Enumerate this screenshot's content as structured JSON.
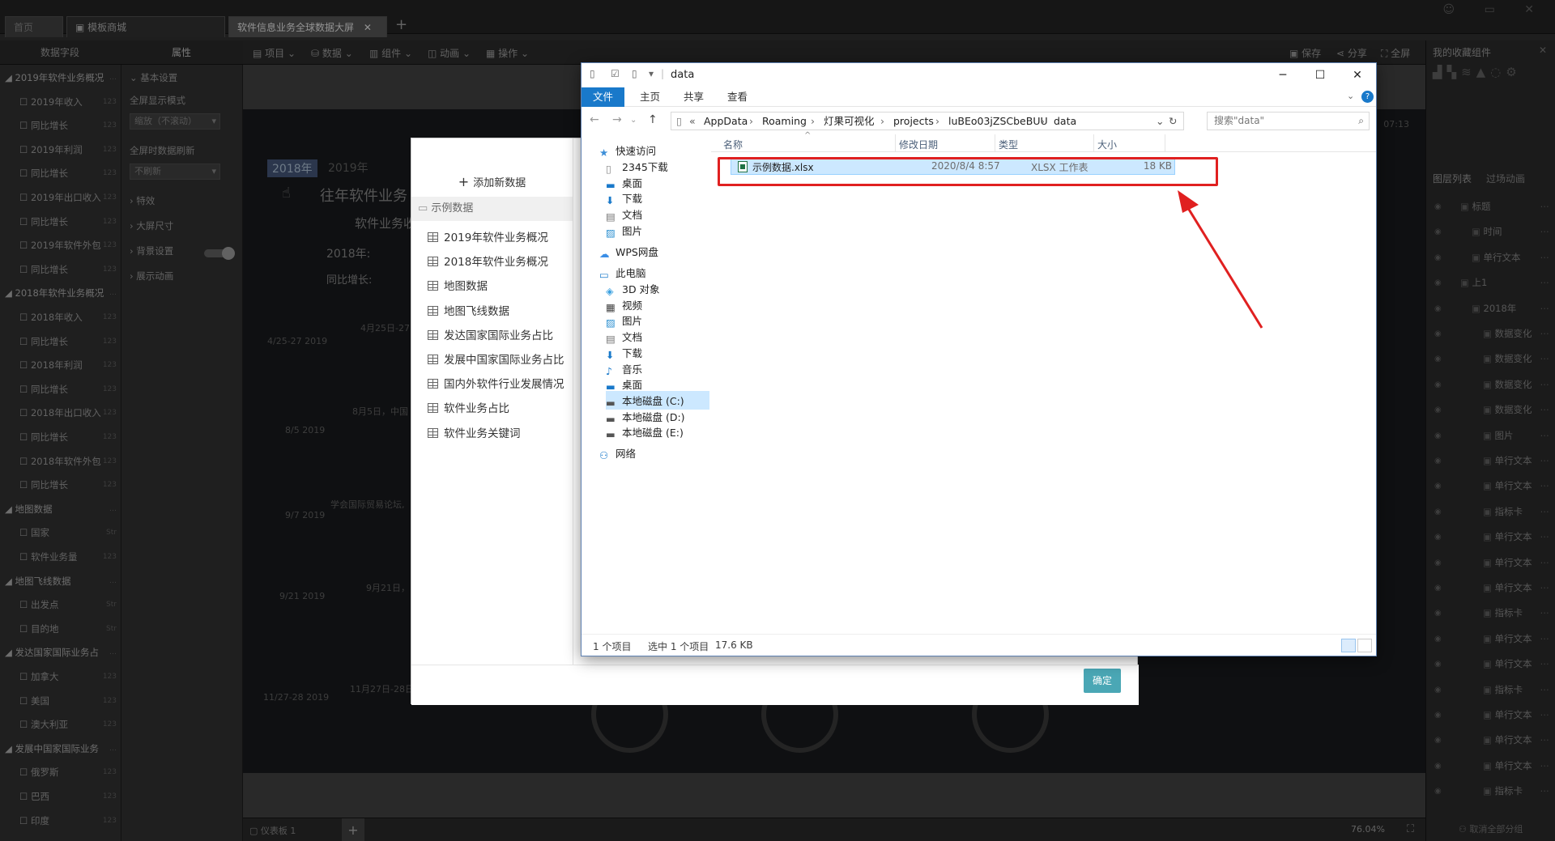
{
  "app": {
    "tabs": [
      {
        "label": "首页"
      },
      {
        "label": "模板商城"
      },
      {
        "label": "软件信息业务全球数据大屏"
      }
    ],
    "new_tab": "+"
  },
  "left": {
    "fields_title": "数据字段",
    "props_title": "属性",
    "fields": [
      {
        "label": "2019年软件业务概况",
        "kind": "group"
      },
      {
        "label": "2019年收入",
        "type": "123"
      },
      {
        "label": "同比增长",
        "type": "123"
      },
      {
        "label": "2019年利润",
        "type": "123"
      },
      {
        "label": "同比增长",
        "type": "123"
      },
      {
        "label": "2019年出口收入",
        "type": "123"
      },
      {
        "label": "同比增长",
        "type": "123"
      },
      {
        "label": "2019年软件外包",
        "type": "123"
      },
      {
        "label": "同比增长",
        "type": "123"
      },
      {
        "label": "2018年软件业务概况",
        "kind": "group"
      },
      {
        "label": "2018年收入",
        "type": "123"
      },
      {
        "label": "同比增长",
        "type": "123"
      },
      {
        "label": "2018年利润",
        "type": "123"
      },
      {
        "label": "同比增长",
        "type": "123"
      },
      {
        "label": "2018年出口收入",
        "type": "123"
      },
      {
        "label": "同比增长",
        "type": "123"
      },
      {
        "label": "2018年软件外包",
        "type": "123"
      },
      {
        "label": "同比增长",
        "type": "123"
      },
      {
        "label": "地图数据",
        "kind": "group"
      },
      {
        "label": "国家",
        "type": "Str"
      },
      {
        "label": "软件业务量",
        "type": "123"
      },
      {
        "label": "地图飞线数据",
        "kind": "group"
      },
      {
        "label": "出发点",
        "type": "Str"
      },
      {
        "label": "目的地",
        "type": "Str"
      },
      {
        "label": "发达国家国际业务占",
        "kind": "group"
      },
      {
        "label": "加拿大",
        "type": "123"
      },
      {
        "label": "美国",
        "type": "123"
      },
      {
        "label": "澳大利亚",
        "type": "123"
      },
      {
        "label": "发展中国家国际业务",
        "kind": "group"
      },
      {
        "label": "俄罗斯",
        "type": "123"
      },
      {
        "label": "巴西",
        "type": "123"
      },
      {
        "label": "印度",
        "type": "123"
      }
    ],
    "props": {
      "basic": "基本设置",
      "fullscreen_mode": "全屏显示模式",
      "fullscreen_mode_value": "缩放（不滚动）",
      "refresh": "全屏时数据刷新",
      "refresh_value": "不刷新",
      "effects": "特效",
      "size": "大屏尺寸",
      "bg": "背景设置",
      "anim": "展示动画"
    }
  },
  "toolbar": {
    "items": [
      "项目",
      "数据",
      "组件",
      "动画",
      "操作"
    ],
    "save": "保存",
    "share": "分享",
    "fullscreen": "全屏"
  },
  "screen": {
    "year_tabs": [
      "2018年",
      "2019年"
    ],
    "title_line": "往年软件业务",
    "subtitle": "软件业务收",
    "year_label": "2018年:",
    "growth_label": "同比增长:",
    "time": "07:13",
    "timeline": [
      {
        "date": "4/25-27 2019",
        "text": "4月25日-27"
      },
      {
        "date": "8/5 2019",
        "text": "8月5日，中国"
      },
      {
        "date": "9/7 2019",
        "text": "学会国际贸易论坛,"
      },
      {
        "date": "9/21 2019",
        "text": "9月21日，"
      },
      {
        "date": "11/27-28 2019",
        "text": "11月27日-28日"
      }
    ]
  },
  "bottom": {
    "dashboard": "仪表板 1",
    "zoom": "76.04%"
  },
  "right": {
    "favorites": "我的收藏组件",
    "tab_layers": "图层列表",
    "tab_transition": "过场动画",
    "layers": [
      "标题",
      "时间",
      "单行文本",
      "上1",
      "2018年",
      "数据变化",
      "数据变化",
      "数据变化",
      "数据变化",
      "图片",
      "单行文本",
      "单行文本",
      "指标卡",
      "单行文本",
      "单行文本",
      "单行文本",
      "指标卡",
      "单行文本",
      "单行文本",
      "指标卡",
      "单行文本",
      "单行文本",
      "单行文本",
      "指标卡"
    ],
    "footer": "取消全部分组"
  },
  "data_dialog": {
    "add": "添加新数据",
    "group": "示例数据",
    "items": [
      "2019年软件业务概况",
      "2018年软件业务概况",
      "地图数据",
      "地图飞线数据",
      "发达国家国际业务占比",
      "发展中国家国际业务占比",
      "国内外软件行业发展情况",
      "软件业务占比",
      "软件业务关键词"
    ],
    "confirm": "确定"
  },
  "explorer": {
    "title": "data",
    "ribbon": [
      "文件",
      "主页",
      "共享",
      "查看"
    ],
    "breadcrumb": [
      "AppData",
      "Roaming",
      "灯果可视化",
      "projects",
      "luBEo03jZSCbeBUU",
      "data"
    ],
    "search_placeholder": "搜索\"data\"",
    "nav": {
      "quick_access": "快速访问",
      "quick": [
        "2345下载",
        "桌面",
        "下载",
        "文档",
        "图片"
      ],
      "wps": "WPS网盘",
      "pc": "此电脑",
      "pc_items": [
        "3D 对象",
        "视频",
        "图片",
        "文档",
        "下载",
        "音乐",
        "桌面"
      ],
      "drives": [
        "本地磁盘 (C:)",
        "本地磁盘 (D:)",
        "本地磁盘 (E:)"
      ],
      "network": "网络"
    },
    "columns": [
      "名称",
      "修改日期",
      "类型",
      "大小"
    ],
    "file": {
      "name": "示例数据.xlsx",
      "date": "2020/8/4 8:57",
      "type": "XLSX 工作表",
      "size": "18 KB"
    },
    "status": {
      "count": "1 个项目",
      "selected": "选中 1 个项目",
      "selected_size": "17.6 KB"
    }
  },
  "colors": {
    "accent": "#1979ca",
    "highlight": "#e02020",
    "confirm": "#4aa7b5"
  }
}
